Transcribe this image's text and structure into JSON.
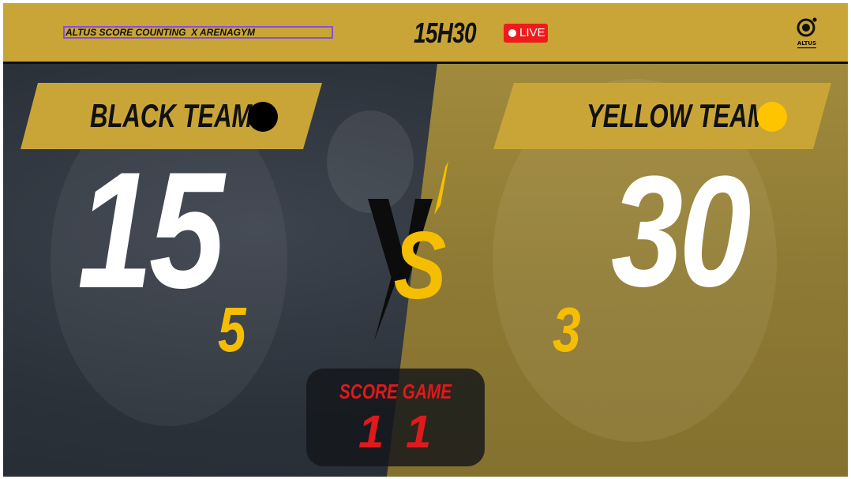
{
  "header": {
    "brand": "ALTUS SCORE COUNTING  X ARENAGYM",
    "time": "15H30",
    "live_label": "LIVE",
    "logo_text": "ALTUS"
  },
  "teams": [
    {
      "name": "BLACK TEAM",
      "color": "#000000",
      "points": "15",
      "games": "5"
    },
    {
      "name": "YELLOW TEAM",
      "color": "#ffc400",
      "points": "30",
      "games": "3"
    }
  ],
  "vs_text": "VS",
  "score_game": {
    "title": "SCORE GAME",
    "left": "1",
    "right": "1"
  },
  "colors": {
    "gold": "#c9a537",
    "live_red": "#ef1b1b",
    "score_red": "#e0191c",
    "games_yellow": "#f5be00"
  }
}
